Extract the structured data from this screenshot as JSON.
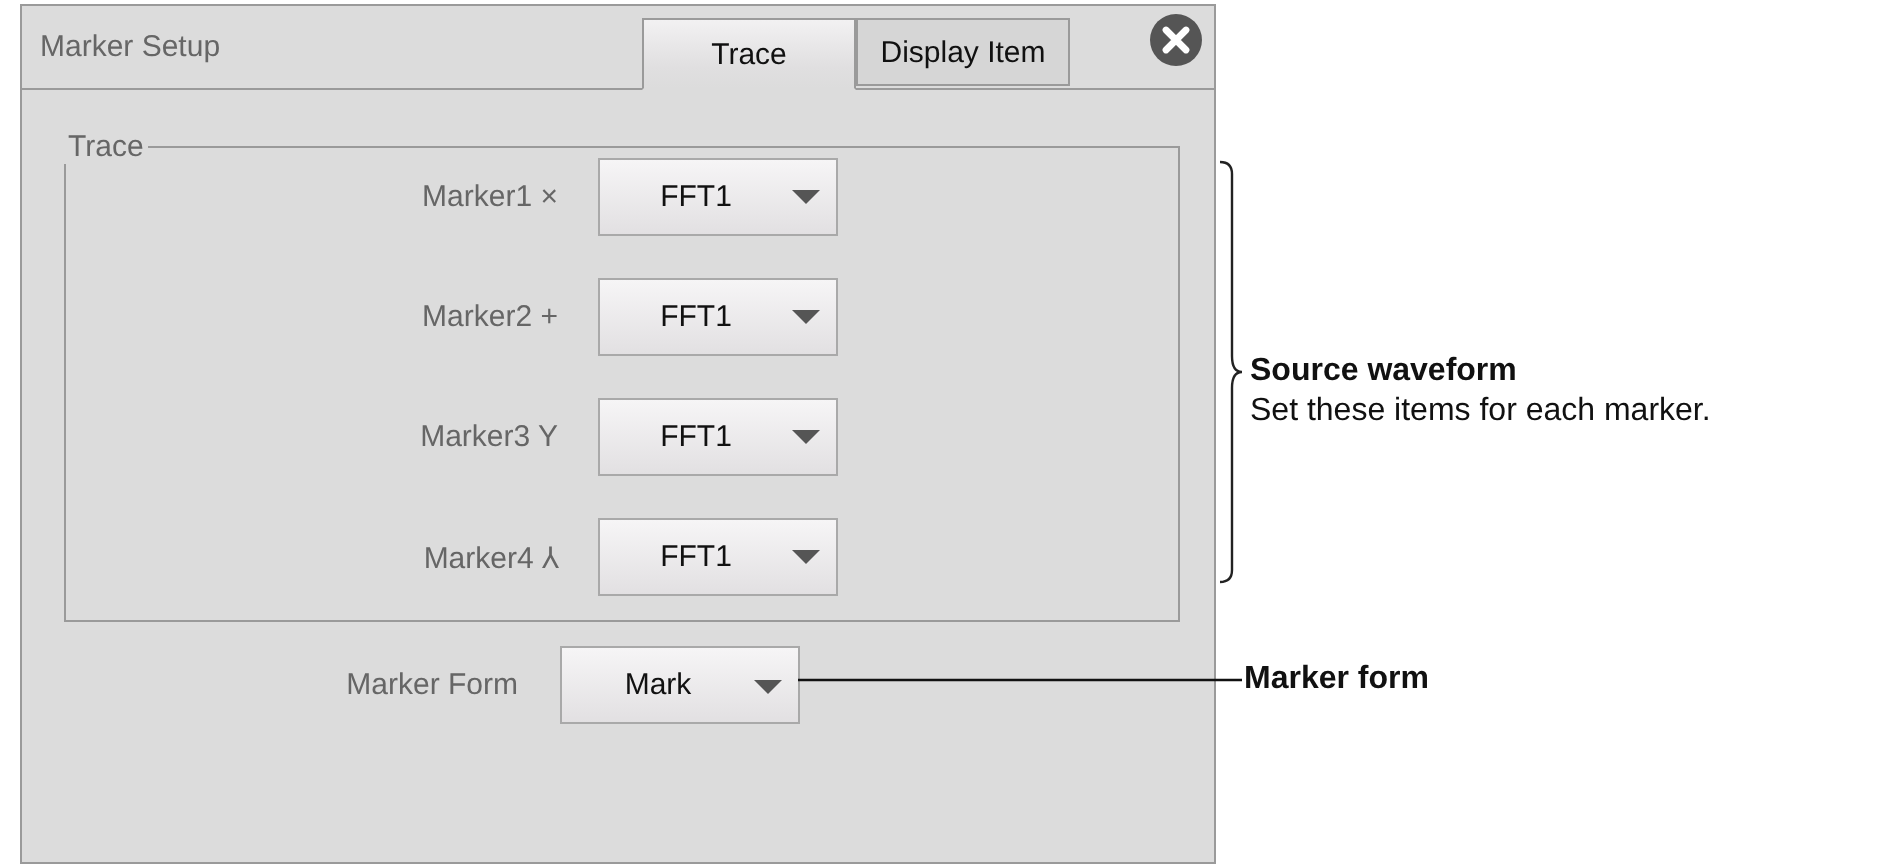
{
  "dialog": {
    "title": "Marker Setup",
    "tabs": [
      {
        "label": "Trace",
        "selected": true
      },
      {
        "label": "Display Item",
        "selected": false
      }
    ],
    "trace_group": {
      "title": "Trace",
      "markers": [
        {
          "label": "Marker1 ×",
          "source": "FFT1"
        },
        {
          "label": "Marker2 +",
          "source": "FFT1"
        },
        {
          "label": "Marker3 Y",
          "source": "FFT1"
        },
        {
          "label": "Marker4 ⅄",
          "source": "FFT1"
        }
      ]
    },
    "marker_form": {
      "label": "Marker Form",
      "value": "Mark"
    }
  },
  "annotations": [
    {
      "kind": "bracket",
      "title": "Source waveform",
      "text": "Set these items for each marker."
    },
    {
      "kind": "leader",
      "title": "Marker form"
    }
  ]
}
